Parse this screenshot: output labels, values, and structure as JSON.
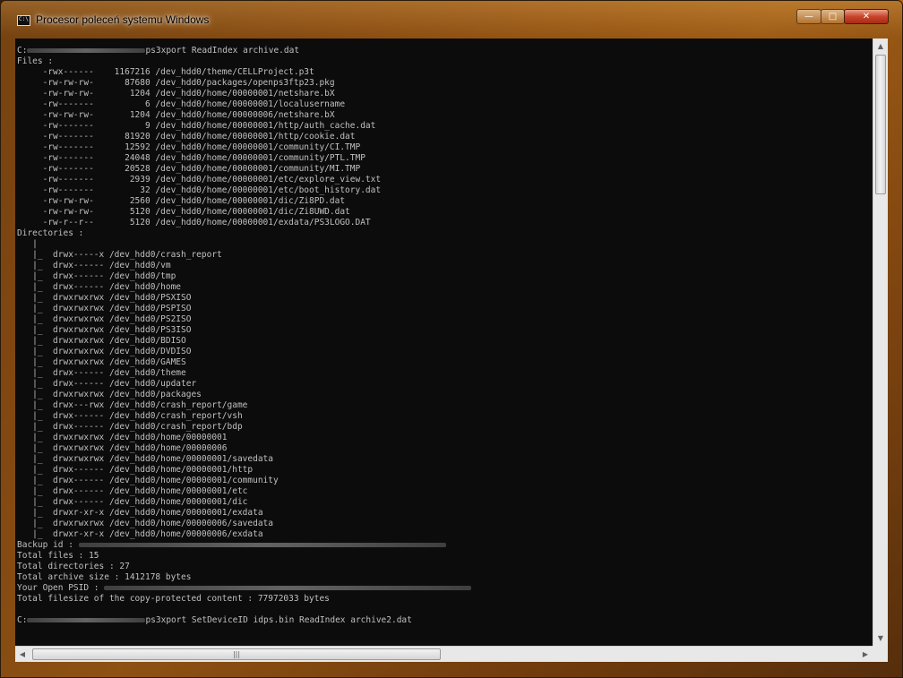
{
  "window": {
    "title": "Procesor poleceń systemu Windows",
    "icon_text": "C:\\.",
    "controls": {
      "minimize_glyph": "—",
      "maximize_glyph": "□",
      "close_glyph": "✕"
    }
  },
  "console": {
    "drive_prefix": "C:",
    "command1": "ps3xport ReadIndex archive.dat",
    "files_header": "Files :",
    "files": [
      {
        "perms": "-rwx------",
        "size": "1167216",
        "path": "/dev_hdd0/theme/CELLProject.p3t"
      },
      {
        "perms": "-rw-rw-rw-",
        "size": "87680",
        "path": "/dev_hdd0/packages/openps3ftp23.pkg"
      },
      {
        "perms": "-rw-rw-rw-",
        "size": "1204",
        "path": "/dev_hdd0/home/00000001/netshare.bX"
      },
      {
        "perms": "-rw-------",
        "size": "6",
        "path": "/dev_hdd0/home/00000001/localusername"
      },
      {
        "perms": "-rw-rw-rw-",
        "size": "1204",
        "path": "/dev_hdd0/home/00000006/netshare.bX"
      },
      {
        "perms": "-rw-------",
        "size": "9",
        "path": "/dev_hdd0/home/00000001/http/auth_cache.dat"
      },
      {
        "perms": "-rw-------",
        "size": "81920",
        "path": "/dev_hdd0/home/00000001/http/cookie.dat"
      },
      {
        "perms": "-rw-------",
        "size": "12592",
        "path": "/dev_hdd0/home/00000001/community/CI.TMP"
      },
      {
        "perms": "-rw-------",
        "size": "24048",
        "path": "/dev_hdd0/home/00000001/community/PTL.TMP"
      },
      {
        "perms": "-rw-------",
        "size": "20528",
        "path": "/dev_hdd0/home/00000001/community/MI.TMP"
      },
      {
        "perms": "-rw-------",
        "size": "2939",
        "path": "/dev_hdd0/home/00000001/etc/explore_view.txt"
      },
      {
        "perms": "-rw-------",
        "size": "32",
        "path": "/dev_hdd0/home/00000001/etc/boot_history.dat"
      },
      {
        "perms": "-rw-rw-rw-",
        "size": "2560",
        "path": "/dev_hdd0/home/00000001/dic/Zi8PD.dat"
      },
      {
        "perms": "-rw-rw-rw-",
        "size": "5120",
        "path": "/dev_hdd0/home/00000001/dic/Zi8UWD.dat"
      },
      {
        "perms": "-rw-r--r--",
        "size": "5120",
        "path": "/dev_hdd0/home/00000001/exdata/PS3LOGO.DAT"
      }
    ],
    "directories_header": "Directories :",
    "tree_root": "|",
    "tree_branch": "|_",
    "directories": [
      {
        "perms": "drwx-----x",
        "path": "/dev_hdd0/crash_report"
      },
      {
        "perms": "drwx------",
        "path": "/dev_hdd0/vm"
      },
      {
        "perms": "drwx------",
        "path": "/dev_hdd0/tmp"
      },
      {
        "perms": "drwx------",
        "path": "/dev_hdd0/home"
      },
      {
        "perms": "drwxrwxrwx",
        "path": "/dev_hdd0/PSXISO"
      },
      {
        "perms": "drwxrwxrwx",
        "path": "/dev_hdd0/PSPISO"
      },
      {
        "perms": "drwxrwxrwx",
        "path": "/dev_hdd0/PS2ISO"
      },
      {
        "perms": "drwxrwxrwx",
        "path": "/dev_hdd0/PS3ISO"
      },
      {
        "perms": "drwxrwxrwx",
        "path": "/dev_hdd0/BDISO"
      },
      {
        "perms": "drwxrwxrwx",
        "path": "/dev_hdd0/DVDISO"
      },
      {
        "perms": "drwxrwxrwx",
        "path": "/dev_hdd0/GAMES"
      },
      {
        "perms": "drwx------",
        "path": "/dev_hdd0/theme"
      },
      {
        "perms": "drwx------",
        "path": "/dev_hdd0/updater"
      },
      {
        "perms": "drwxrwxrwx",
        "path": "/dev_hdd0/packages"
      },
      {
        "perms": "drwx---rwx",
        "path": "/dev_hdd0/crash_report/game"
      },
      {
        "perms": "drwx------",
        "path": "/dev_hdd0/crash_report/vsh"
      },
      {
        "perms": "drwx------",
        "path": "/dev_hdd0/crash_report/bdp"
      },
      {
        "perms": "drwxrwxrwx",
        "path": "/dev_hdd0/home/00000001"
      },
      {
        "perms": "drwxrwxrwx",
        "path": "/dev_hdd0/home/00000006"
      },
      {
        "perms": "drwxrwxrwx",
        "path": "/dev_hdd0/home/00000001/savedata"
      },
      {
        "perms": "drwx------",
        "path": "/dev_hdd0/home/00000001/http"
      },
      {
        "perms": "drwx------",
        "path": "/dev_hdd0/home/00000001/community"
      },
      {
        "perms": "drwx------",
        "path": "/dev_hdd0/home/00000001/etc"
      },
      {
        "perms": "drwx------",
        "path": "/dev_hdd0/home/00000001/dic"
      },
      {
        "perms": "drwxr-xr-x",
        "path": "/dev_hdd0/home/00000001/exdata"
      },
      {
        "perms": "drwxrwxrwx",
        "path": "/dev_hdd0/home/00000006/savedata"
      },
      {
        "perms": "drwxr-xr-x",
        "path": "/dev_hdd0/home/00000006/exdata"
      }
    ],
    "backup_id_label": "Backup id :",
    "total_files": "Total files : 15",
    "total_directories": "Total directories : 27",
    "total_archive_size": "Total archive size : 1412178 bytes",
    "open_psid_label": "Your Open PSID :",
    "copy_protected": "Total filesize of the copy-protected content : 77972033 bytes",
    "command2": "ps3xport SetDeviceID idps.bin ReadIndex archive2.dat"
  },
  "scrollbars": {
    "up_glyph": "▲",
    "down_glyph": "▼",
    "left_glyph": "◀",
    "right_glyph": "▶",
    "grip_glyph": "|||"
  },
  "colors": {
    "console_bg": "#0c0c0c",
    "console_fg": "#c0c0c0",
    "close_button": "#c8452a"
  }
}
